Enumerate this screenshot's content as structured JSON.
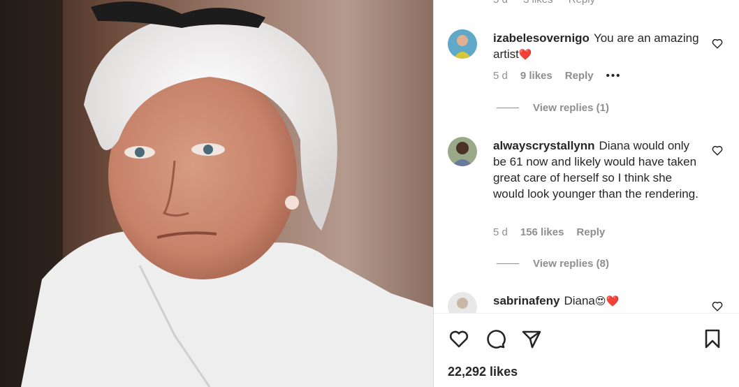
{
  "post": {
    "photo_alt": "Portrait of white-haired woman in white shirt",
    "likes_total": "22,292 likes"
  },
  "cut_row": {
    "age": "5 d",
    "likes": "3 likes",
    "reply": "Reply"
  },
  "comments": [
    {
      "username": "izabelesovernigo",
      "text": "You are an amazing artist",
      "emoji": "❤️",
      "age": "5 d",
      "likes": "9 likes",
      "reply": "Reply",
      "more": "•••",
      "view_replies": "View replies (1)"
    },
    {
      "username": "alwayscrystallynn",
      "text": "Diana would only be 61 now and likely would have taken great care of herself so I think she would look younger than the rendering.",
      "age": "5 d",
      "likes": "156 likes",
      "reply": "Reply",
      "view_replies": "View replies (8)"
    },
    {
      "username": "sabrinafeny",
      "text": "Diana",
      "emoji": "😍❤️"
    }
  ],
  "icons": [
    "heart-icon",
    "comment-icon",
    "share-icon",
    "bookmark-icon"
  ],
  "colors": {
    "text": "#262626",
    "secondary": "#8e8e8e",
    "divider": "#dbdbdb"
  }
}
